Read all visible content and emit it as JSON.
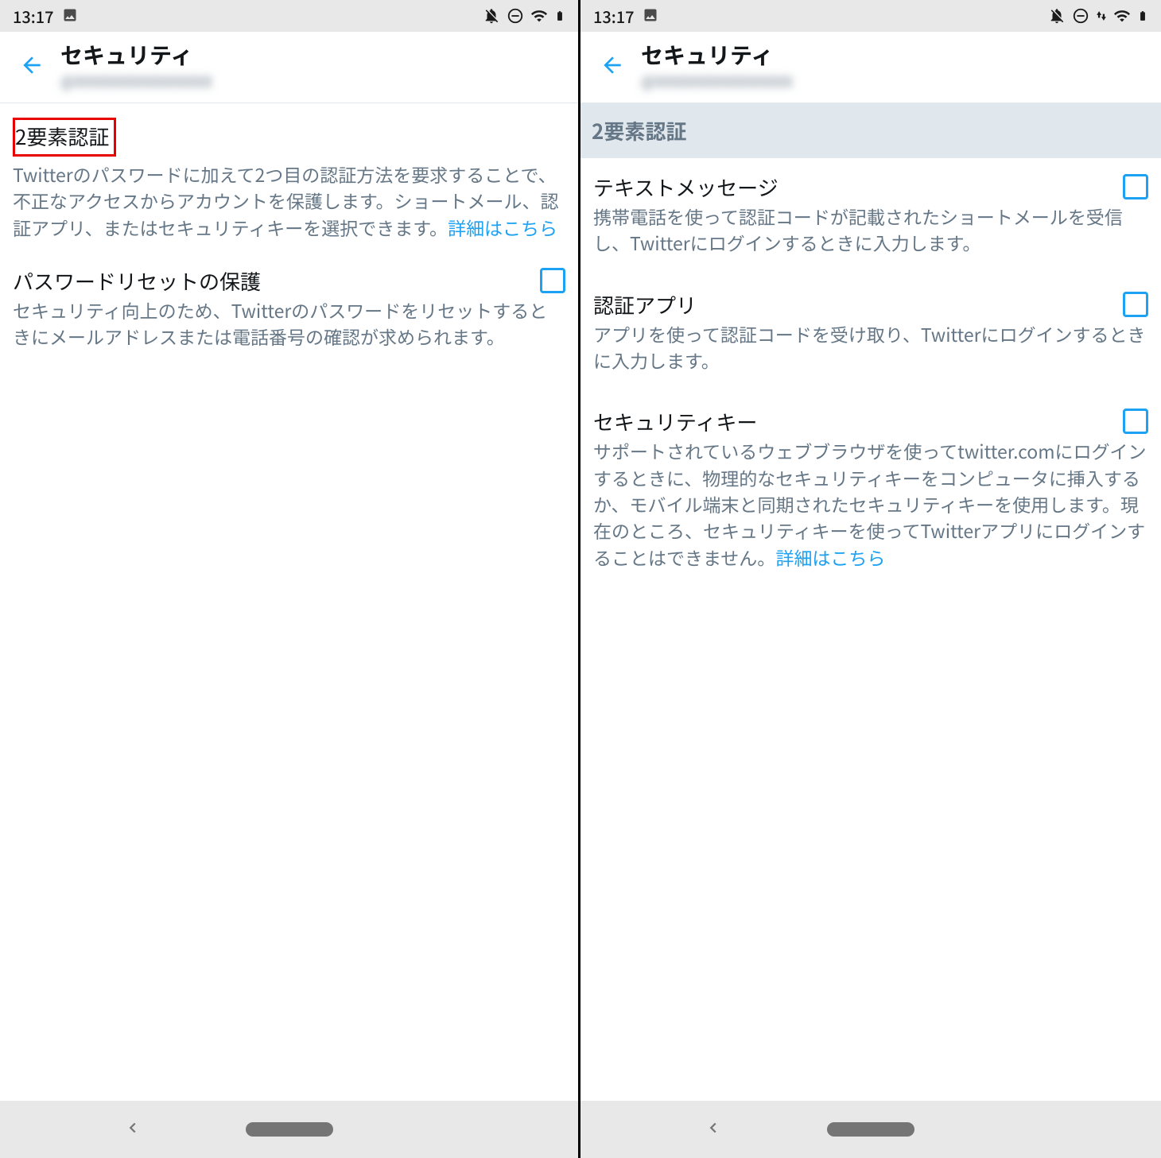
{
  "statusBar": {
    "time": "13:17"
  },
  "left": {
    "header": {
      "title": "セキュリティ",
      "subtitle": "@XXXXXXXXXXXXXXX"
    },
    "twoFactor": {
      "title": "2要素認証",
      "desc_a": "Twitterのパスワードに加えて2つ目の認証方法を要求することで、不正なアクセスからアカウントを保護します。ショートメール、認証アプリ、またはセキュリティキーを選択できます。",
      "link": "詳細はこちら"
    },
    "passwordReset": {
      "title": "パスワードリセットの保護",
      "desc": "セキュリティ向上のため、Twitterのパスワードをリセットするときにメールアドレスまたは電話番号の確認が求められます。"
    }
  },
  "right": {
    "header": {
      "title": "セキュリティ",
      "subtitle": "@XXXXXXXXXXXXXXX"
    },
    "sectionHeader": "2要素認証",
    "textMessage": {
      "title": "テキストメッセージ",
      "desc": "携帯電話を使って認証コードが記載されたショートメールを受信し、Twitterにログインするときに入力します。"
    },
    "authApp": {
      "title": "認証アプリ",
      "desc": "アプリを使って認証コードを受け取り、Twitterにログインするときに入力します。"
    },
    "securityKey": {
      "title": "セキュリティキー",
      "desc_a": "サポートされているウェブブラウザを使ってtwitter.comにログインするときに、物理的なセキュリティキーをコンピュータに挿入するか、モバイル端末と同期されたセキュリティキーを使用します。現在のところ、セキュリティキーを使ってTwitterアプリにログインすることはできません。",
      "link": "詳細はこちら"
    }
  }
}
